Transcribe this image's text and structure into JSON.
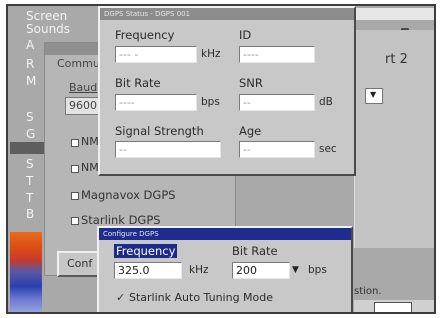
{
  "left_menu": {
    "screen": "Screen",
    "sounds": "Sounds",
    "letters": [
      "A",
      "R",
      "M",
      "S",
      "G",
      "S",
      "T",
      "T",
      "B"
    ]
  },
  "comm_panel": {
    "title": "Commu",
    "baud_label": "Baud",
    "baud_value": "9600",
    "checks": [
      {
        "label": "NM",
        "checked": false
      },
      {
        "label": "NM",
        "checked": false
      },
      {
        "label": "Magnavox DGPS",
        "checked": false
      },
      {
        "label": "Starlink DGPS",
        "checked": false
      }
    ],
    "config_button": "Conf"
  },
  "right_panel": {
    "port_label": "rt 2",
    "partial_text": "stion."
  },
  "status_window": {
    "title": "DGPS Status - DGPS 001",
    "frequency": {
      "label": "Frequency",
      "value": "--- -",
      "unit": "kHz"
    },
    "id": {
      "label": "ID",
      "value": "----"
    },
    "bit_rate": {
      "label": "Bit Rate",
      "value": "----",
      "unit": "bps"
    },
    "snr": {
      "label": "SNR",
      "value": "--",
      "unit": "dB"
    },
    "signal_strength": {
      "label": "Signal Strength",
      "value": "--"
    },
    "age": {
      "label": "Age",
      "value": "--",
      "unit": "sec"
    }
  },
  "config_window": {
    "title": "Configure DGPS",
    "frequency": {
      "label": "Frequency",
      "value": "325.0",
      "unit": "kHz"
    },
    "bit_rate": {
      "label": "Bit Rate",
      "value": "200",
      "unit": "bps"
    },
    "auto_tuning": {
      "label": "Starlink Auto Tuning Mode",
      "checked": true
    }
  },
  "colors": {
    "title_active": "#1e2c8e",
    "title_inactive": "#8c8c8c",
    "highlight": "#1c2a8c"
  }
}
